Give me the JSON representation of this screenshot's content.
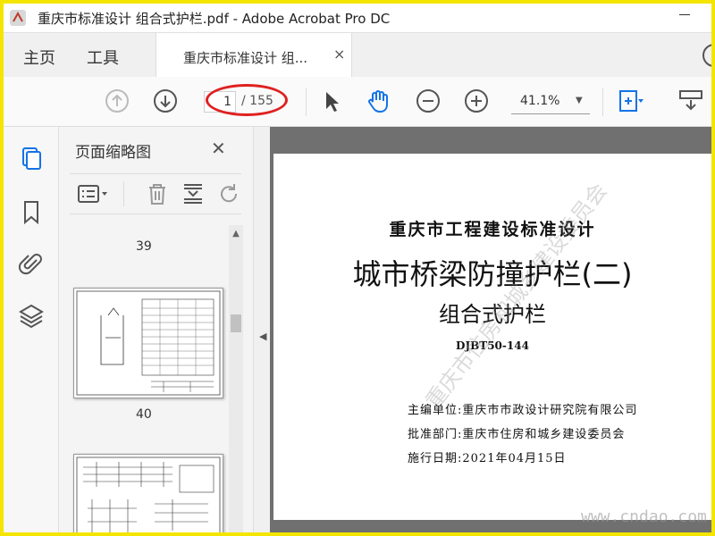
{
  "window": {
    "title": "重庆市标准设计 组合式护栏.pdf - Adobe Acrobat Pro DC",
    "accent_color": "#f4e500"
  },
  "tabs": {
    "home": "主页",
    "tools": "工具",
    "document_tab": "重庆市标准设计 组...",
    "document_tab_close": "×"
  },
  "toolbar": {
    "current_page": "1",
    "page_total": "/ 155",
    "zoom": "41.1%"
  },
  "thumbnails_panel": {
    "title": "页面缩略图",
    "close": "✕",
    "page_labels": [
      "39",
      "40"
    ]
  },
  "document": {
    "series": "重庆市工程建设标准设计",
    "title": "城市桥梁防撞护栏(二)",
    "subtitle": "组合式护栏",
    "code": "DJBT50-144",
    "editor": "主编单位:重庆市市政设计研究院有限公司",
    "approver": "批准部门:重庆市住房和城乡建设委员会",
    "date": "施行日期:2021年04月15日",
    "watermark": "重庆市住房和城乡建设委员会"
  },
  "overlay": {
    "site_watermark": "www.cndao.com"
  }
}
